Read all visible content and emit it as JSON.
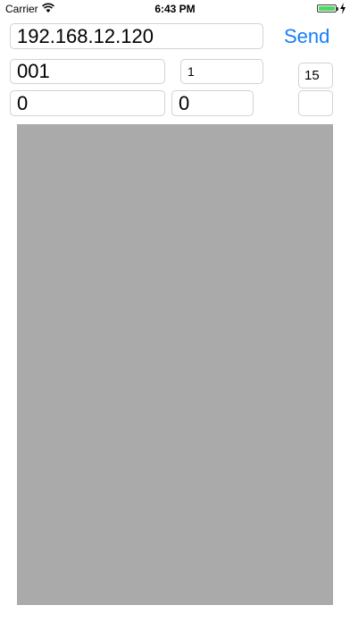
{
  "status_bar": {
    "carrier": "Carrier",
    "time": "6:43 PM",
    "icons": [
      "wifi-icon",
      "battery-icon",
      "charging-bolt-icon"
    ],
    "battery_color": "#4cd964"
  },
  "form": {
    "ip_address": "192.168.12.120",
    "send_label": "Send",
    "send_color": "#157efb",
    "field_001": "001",
    "field_1": "1",
    "field_15": "15",
    "field_0_left": "0",
    "field_0_mid": "0",
    "field_empty": ""
  },
  "canvas": {
    "color": "#aaaaaa"
  }
}
